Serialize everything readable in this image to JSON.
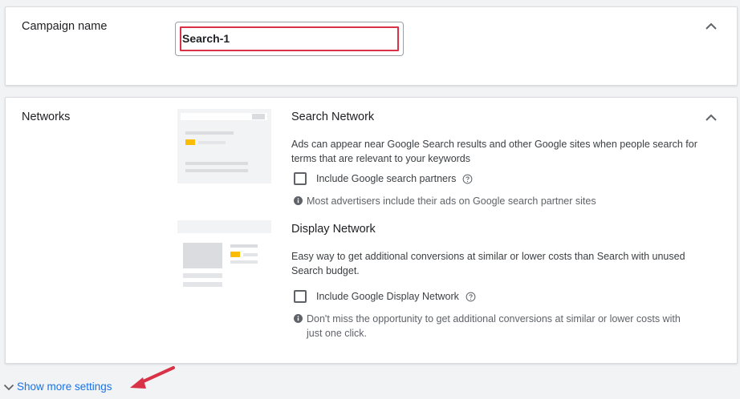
{
  "campaign": {
    "label": "Campaign name",
    "name_value": "Search-1"
  },
  "networks": {
    "label": "Networks",
    "search": {
      "title": "Search Network",
      "description": "Ads can appear near Google Search results and other Google sites when people search for terms that are relevant to your keywords",
      "checkbox_label": "Include Google search partners",
      "info": "Most advertisers include their ads on Google search partner sites"
    },
    "display": {
      "title": "Display Network",
      "description": "Easy way to get additional conversions at similar or lower costs than Search with unused Search budget.",
      "checkbox_label": "Include Google Display Network",
      "info": "Don't miss the opportunity to get additional conversions at similar or lower costs with just one click."
    }
  },
  "footer": {
    "show_more_label": "Show more settings"
  },
  "icons": {
    "collapse": "chevron-up-icon",
    "help": "help-circle-icon",
    "info": "info-circle-icon",
    "expand": "chevron-down-icon",
    "annotation": "red-arrow"
  },
  "colors": {
    "link": "#1a73e8",
    "highlight": "#d93247",
    "accent_yellow": "#fbbc04"
  }
}
